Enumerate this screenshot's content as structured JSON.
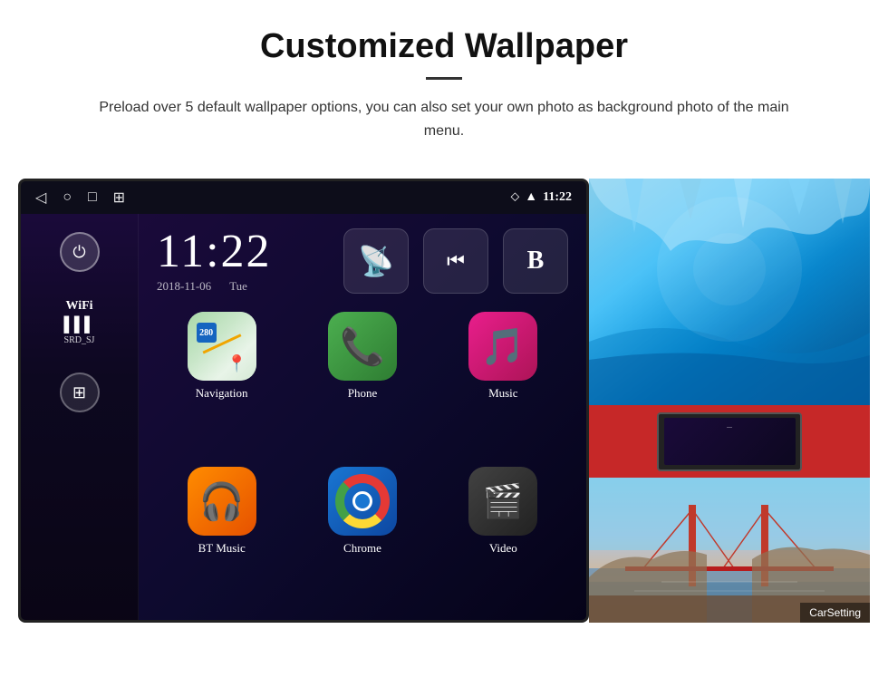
{
  "header": {
    "title": "Customized Wallpaper",
    "subtitle": "Preload over 5 default wallpaper options, you can also set your own photo as background photo of the main menu."
  },
  "device": {
    "status_bar": {
      "time": "11:22",
      "nav_back": "◁",
      "nav_home": "○",
      "nav_square": "□",
      "nav_photo": "⊞",
      "location_icon": "📍",
      "wifi_icon": "▲",
      "time_label": "11:22"
    },
    "clock": {
      "time": "11:22",
      "date": "2018-11-06",
      "day": "Tue"
    },
    "sidebar": {
      "wifi_label": "WiFi",
      "wifi_name": "SRD_SJ"
    },
    "apps": [
      {
        "name": "Navigation",
        "icon_type": "navigation"
      },
      {
        "name": "Phone",
        "icon_type": "phone"
      },
      {
        "name": "Music",
        "icon_type": "music"
      },
      {
        "name": "BT Music",
        "icon_type": "btmusic"
      },
      {
        "name": "Chrome",
        "icon_type": "chrome"
      },
      {
        "name": "Video",
        "icon_type": "video"
      }
    ]
  },
  "wallpapers": [
    {
      "type": "ice",
      "alt": "Ice cave wallpaper"
    },
    {
      "type": "bridge",
      "alt": "Bridge wallpaper"
    }
  ]
}
